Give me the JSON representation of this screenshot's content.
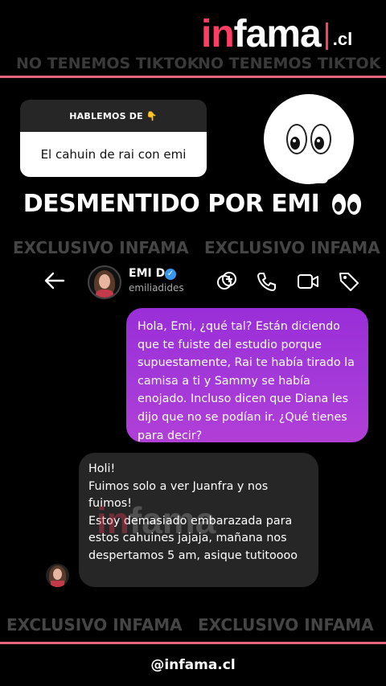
{
  "brand": {
    "logo_in": "in",
    "logo_fama": "fama",
    "logo_cl": ".cl",
    "footer_handle": "@infama.cl"
  },
  "watermarks": {
    "top": [
      "NO TENEMOS TIKTOK",
      "NO TENEMOS TIKTOK"
    ],
    "middle": [
      "EXCLUSIVO INFAMA",
      "EXCLUSIVO INFAMA"
    ],
    "bottom": [
      "EXCLUSIVO INFAMA",
      "EXCLUSIVO INFAMA"
    ]
  },
  "question_card": {
    "header": "HABLEMOS DE 👇",
    "body": "El cahuin de rai con emi"
  },
  "headline": "DESMENTIDO POR EMI",
  "chat_header": {
    "name": "EMI D",
    "verified": "✓",
    "handle": "emiliadides",
    "icons": [
      "back-arrow-icon",
      "avatar",
      "verified-badge-icon",
      "add-people-icon",
      "phone-icon",
      "video-call-icon",
      "tag-icon"
    ]
  },
  "messages": [
    {
      "direction": "sent",
      "text": "Hola, Emi, ¿qué tal? Están diciendo que te fuiste del estudio porque supuestamente, Rai te había tirado la camisa a ti y Sammy se había enojado. Incluso dicen que Diana les dijo que no se podían ir. ¿Qué tienes para decir?"
    },
    {
      "direction": "received",
      "text": "Holi!\nFuimos solo a ver Juanfra y nos fuimos!\nEstoy demasiado embarazada para estos cahuines jajaja, mañana nos despertamos 5 am, asique tutitoooo"
    }
  ],
  "colors": {
    "accent": "#ff3d62",
    "sent_bubble": "#a53ad9",
    "received_bubble": "#262626",
    "divider": "#e6677d"
  }
}
